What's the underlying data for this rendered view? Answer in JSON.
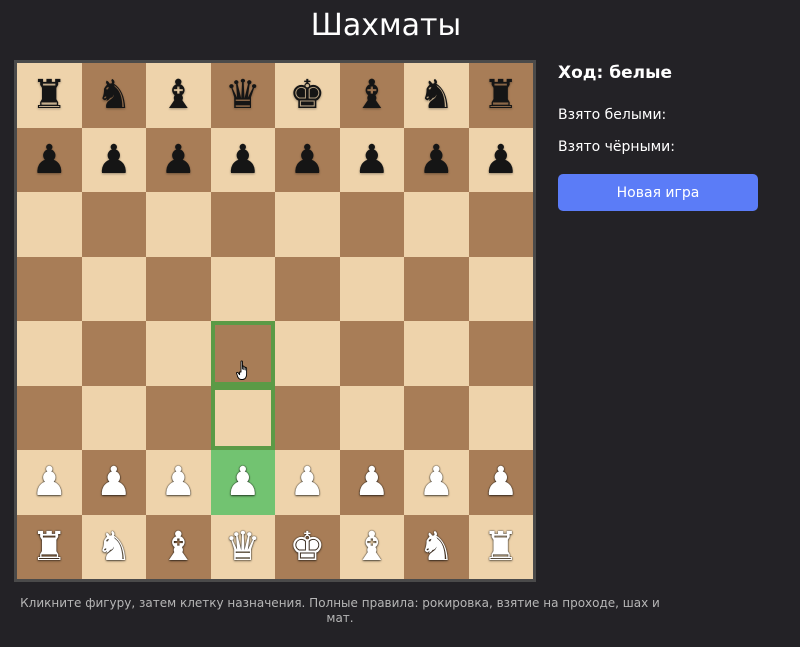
{
  "title": "Шахматы",
  "board": {
    "rows": [
      [
        "♜",
        "♞",
        "♝",
        "♛",
        "♚",
        "♝",
        "♞",
        "♜"
      ],
      [
        "♟",
        "♟",
        "♟",
        "♟",
        "♟",
        "♟",
        "♟",
        "♟"
      ],
      [
        "",
        "",
        "",
        "",
        "",
        "",
        "",
        ""
      ],
      [
        "",
        "",
        "",
        "",
        "",
        "",
        "",
        ""
      ],
      [
        "",
        "",
        "",
        "",
        "",
        "",
        "",
        ""
      ],
      [
        "",
        "",
        "",
        "",
        "",
        "",
        "",
        ""
      ],
      [
        "♙",
        "♙",
        "♙",
        "♙",
        "♙",
        "♙",
        "♙",
        "♙"
      ],
      [
        "♖",
        "♘",
        "♗",
        "♕",
        "♔",
        "♗",
        "♘",
        "♖"
      ]
    ],
    "selected": "d2",
    "move_hints": [
      "d3",
      "d4"
    ],
    "colors": {
      "light_square": "#eed3ab",
      "dark_square": "#a87d57",
      "selected_square": "#72c371",
      "hint_outline": "#5b9a46"
    }
  },
  "sidebar": {
    "turn_label": "Ход: белые",
    "captured_by_white_label": "Взято белыми:",
    "captured_by_black_label": "Взято чёрными:",
    "new_game_label": "Новая игра",
    "accent_color": "#5b7cf7"
  },
  "footer_text": "Кликните фигуру, затем клетку назначения. Полные правила: рокировка, взятие на проходе, шах и мат."
}
